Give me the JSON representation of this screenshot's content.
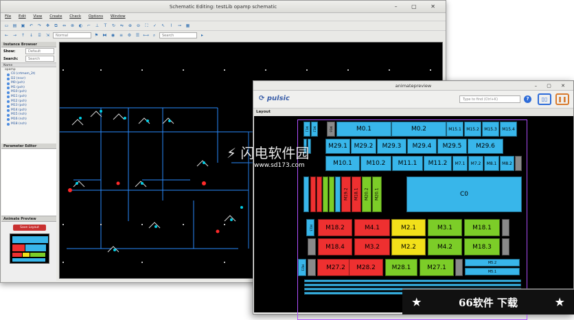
{
  "schematic": {
    "title": "Schematic Editing: testLib opamp schematic",
    "menu": [
      "File",
      "Edit",
      "View",
      "Create",
      "Check",
      "Options",
      "Window"
    ],
    "view_select": "Normal",
    "search_placeholder": "Search",
    "instance_browser": {
      "title": "Instance Browser",
      "show_label": "Show:",
      "show_value": "Default",
      "search_label": "Search:",
      "search_placeholder": "Search",
      "column_header": "Name",
      "root": "opamp",
      "items": [
        "C0 (crtmom_2t)",
        "D2 (nsvr)",
        "M0 (pch)",
        "M1 (pch)",
        "M10 (pch)",
        "M11 (pch)",
        "M12 (pch)",
        "M13 (pch)",
        "M14 (pch)",
        "M15 (nch)",
        "M16 (nch)",
        "M18 (nch)"
      ]
    },
    "parameter_editor": {
      "title": "Parameter Editor"
    },
    "animate_preview": {
      "title": "Animate Preview",
      "save_button": "Save Layout"
    }
  },
  "animate": {
    "title": "animatepreview",
    "logo": "pulsic",
    "find_placeholder": "Type to find (Ctrl+K)",
    "layout_label": "Layout",
    "blocks": {
      "m0_1": "M0.1",
      "m0_2": "M0.2",
      "m15_1": "M15.1",
      "m15_2": "M15.2",
      "m15_3": "M15.3",
      "m15_4": "M15.4",
      "m29_1": "M29.1",
      "m29_2": "M29.2",
      "m29_3": "M29.3",
      "m29_4": "M29.4",
      "m29_5": "M29.5",
      "m29_6": "M29.6",
      "m10_1": "M10.1",
      "m10_2": "M10.2",
      "m11_1": "M11.1",
      "m11_2": "M11.2",
      "m7_1": "M7.1",
      "m7_2": "M7.2",
      "m8_1": "M8.1",
      "m8_2": "M8.2",
      "m11": "M11",
      "m12": "M12",
      "m16": "M16",
      "m19_2": "M19.2",
      "m18_1b": "M18.1",
      "m20_2": "M20.2",
      "m20_1": "M20.1",
      "c0": "C0",
      "m13": "M13",
      "m18_2": "M18.2",
      "m4_1": "M4.1",
      "m2_1": "M2.1",
      "m3_1": "M3.1",
      "m18_1": "M18.1",
      "m18_4": "M18.4",
      "m3_2": "M3.2",
      "m2_2": "M2.2",
      "m4_2": "M4.2",
      "m18_3": "M18.3",
      "m21": "M21",
      "m27_2": "M27.2",
      "m28_2": "M28.2",
      "m28_1": "M28.1",
      "m27_1": "M27.1",
      "m5_2": "M5.2",
      "m5_1": "M5.1"
    }
  },
  "watermark": {
    "text": "闪电软件园",
    "url": "www.sd173.com"
  },
  "banner": {
    "star": "★",
    "text": "66软件 下载"
  }
}
